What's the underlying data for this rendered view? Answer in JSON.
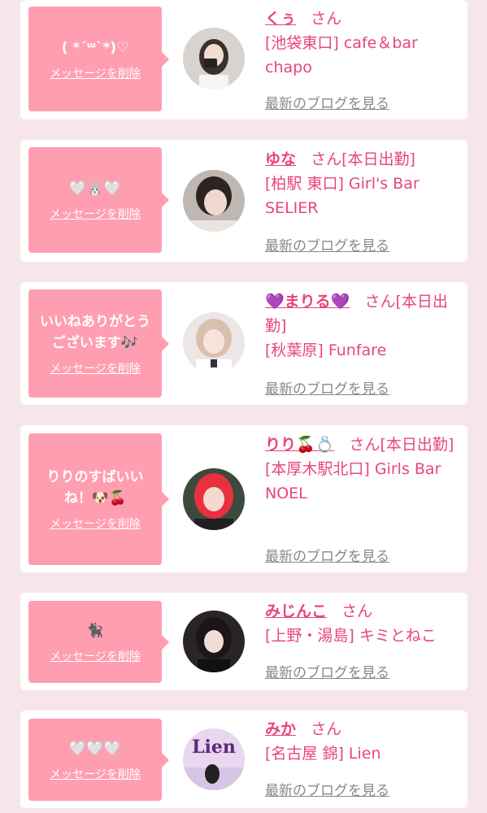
{
  "cards": [
    {
      "message": "( *´ᵚ`*)♡",
      "delete_label": "メッセージを削除",
      "name": "くぅ",
      "suffix": "さん",
      "shop": "[池袋東口] cafe＆bar chapo",
      "blog_label": "最新のブログを見る"
    },
    {
      "message": "🤍🐰🤍",
      "delete_label": "メッセージを削除",
      "name": "ゆな",
      "suffix": "さん[本日出勤]",
      "shop": "[柏駅 東口] Girl's Bar SELIER",
      "blog_label": "最新のブログを見る"
    },
    {
      "message": "いいねありがとうございます🎶",
      "delete_label": "メッセージを削除",
      "name": "💜まりる💜",
      "suffix": "さん[本日出勤]",
      "shop": "[秋葉原] Funfare",
      "blog_label": "最新のブログを見る"
    },
    {
      "message": "りりのすばいいね！🐶🍒",
      "delete_label": "メッセージを削除",
      "name": "りり🍒💍",
      "suffix": "さん[本日出勤]",
      "shop": "[本厚木駅北口] Girls Bar NOEL",
      "blog_label": "最新のブログを見る"
    },
    {
      "message": "🐈‍⬛",
      "delete_label": "メッセージを削除",
      "name": "みじんこ",
      "suffix": "さん",
      "shop": "[上野・湯島] キミとねこ",
      "blog_label": "最新のブログを見る"
    },
    {
      "message": "🤍🤍🤍",
      "delete_label": "メッセージを削除",
      "name": "みか",
      "suffix": "さん",
      "shop": "[名古屋 錦] Lien",
      "blog_label": "最新のブログを見る"
    }
  ],
  "avatar_logo_text": "Lien",
  "colors": {
    "bubble": "#ff9eb0",
    "accent": "#e8457a",
    "background": "#f6e6ea",
    "link_gray": "#888888"
  }
}
